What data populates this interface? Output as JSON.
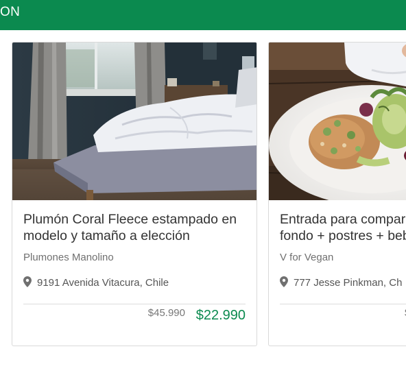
{
  "header": {
    "title": "ON",
    "bg_color": "#0b8a4f"
  },
  "cards": [
    {
      "title": "Plumón Coral Fleece estampado en\nmodelo y tamaño a elección",
      "merchant": "Plumones Manolino",
      "location": "9191 Avenida Vitacura, Chile",
      "price_old": "$45.990",
      "price_new": "$22.990",
      "image": "bedroom-photo",
      "icon": "map-pin-icon"
    },
    {
      "title": "Entrada para compar\nfondo + postres + beb",
      "merchant": "V for Vegan",
      "location": "777 Jesse Pinkman, Ch",
      "price_old": "$",
      "image": "vegan-dish-photo",
      "icon": "map-pin-icon"
    }
  ],
  "colors": {
    "accent": "#0b8a4f",
    "text": "#333333",
    "muted": "#707070"
  }
}
